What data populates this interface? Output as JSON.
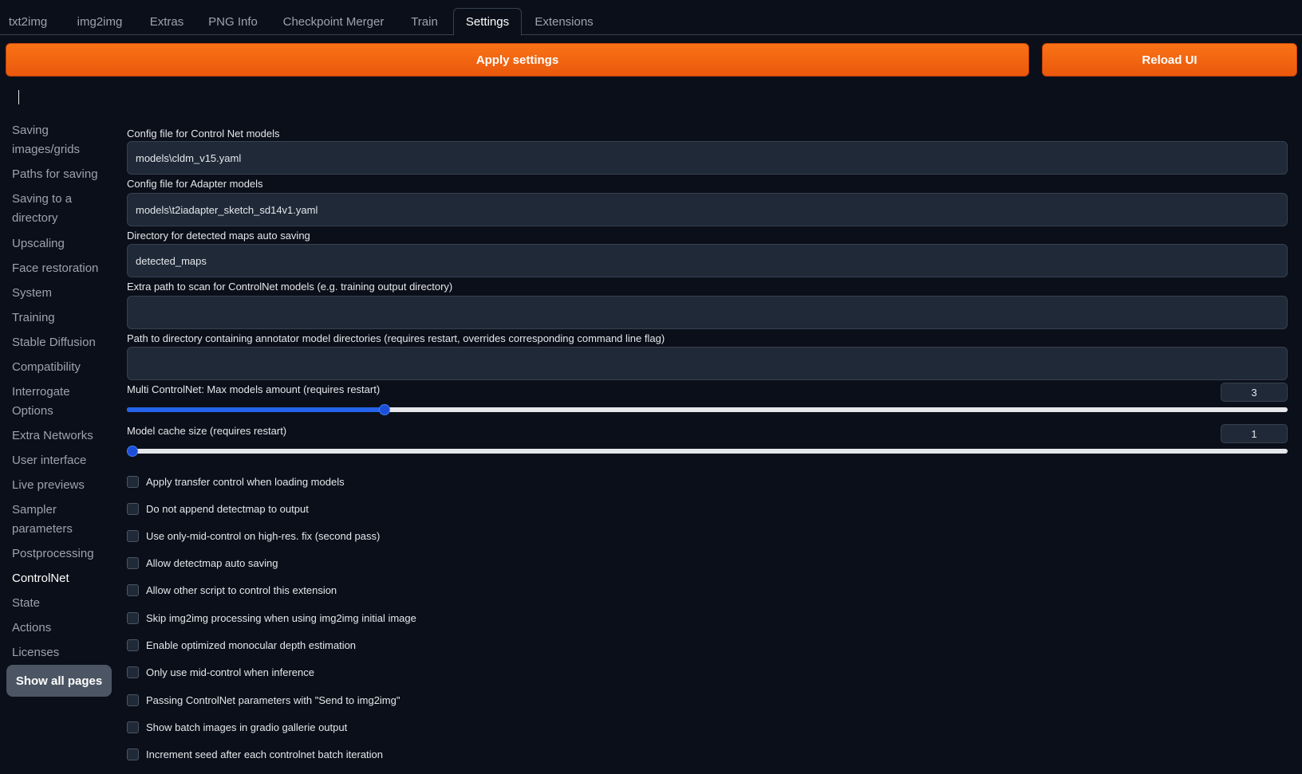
{
  "tabs": [
    {
      "label": "txt2img",
      "active": false
    },
    {
      "label": "img2img",
      "active": false
    },
    {
      "label": "Extras",
      "active": false
    },
    {
      "label": "PNG Info",
      "active": false
    },
    {
      "label": "Checkpoint Merger",
      "active": false
    },
    {
      "label": "Train",
      "active": false
    },
    {
      "label": "Settings",
      "active": true
    },
    {
      "label": "Extensions",
      "active": false
    }
  ],
  "toolbar": {
    "apply_label": "Apply settings",
    "reload_label": "Reload UI"
  },
  "sidebar": {
    "items": [
      "Saving images/grids",
      "Paths for saving",
      "Saving to a directory",
      "Upscaling",
      "Face restoration",
      "System",
      "Training",
      "Stable Diffusion",
      "Compatibility",
      "Interrogate Options",
      "Extra Networks",
      "User interface",
      "Live previews",
      "Sampler parameters",
      "Postprocessing",
      "ControlNet",
      "State",
      "Actions",
      "Licenses"
    ],
    "active_item": "ControlNet",
    "show_all_label": "Show all pages"
  },
  "fields": [
    {
      "label": "Config file for Control Net models",
      "value": "models\\cldm_v15.yaml"
    },
    {
      "label": "Config file for Adapter models",
      "value": "models\\t2iadapter_sketch_sd14v1.yaml"
    },
    {
      "label": "Directory for detected maps auto saving",
      "value": "detected_maps"
    },
    {
      "label": "Extra path to scan for ControlNet models (e.g. training output directory)",
      "value": ""
    },
    {
      "label": "Path to directory containing annotator model directories (requires restart, overrides corresponding command line flag)",
      "value": ""
    }
  ],
  "sliders": [
    {
      "label": "Multi ControlNet: Max models amount (requires restart)",
      "value": "3",
      "fraction": 0.222
    },
    {
      "label": "Model cache size (requires restart)",
      "value": "1",
      "fraction": 0.0
    }
  ],
  "checkboxes": [
    {
      "label": "Apply transfer control when loading models",
      "checked": false
    },
    {
      "label": "Do not append detectmap to output",
      "checked": false
    },
    {
      "label": "Use only-mid-control on high-res. fix (second pass)",
      "checked": false
    },
    {
      "label": "Allow detectmap auto saving",
      "checked": false
    },
    {
      "label": "Allow other script to control this extension",
      "checked": false
    },
    {
      "label": "Skip img2img processing when using img2img initial image",
      "checked": false
    },
    {
      "label": "Enable optimized monocular depth estimation",
      "checked": false
    },
    {
      "label": "Only use mid-control when inference",
      "checked": false
    },
    {
      "label": "Passing ControlNet parameters with \"Send to img2img\"",
      "checked": false
    },
    {
      "label": "Show batch images in gradio gallerie output",
      "checked": false
    },
    {
      "label": "Increment seed after each controlnet batch iteration",
      "checked": false
    }
  ],
  "colors": {
    "accent": "#f97316",
    "slider_fill": "#2563eb",
    "background": "#0b0f19"
  }
}
